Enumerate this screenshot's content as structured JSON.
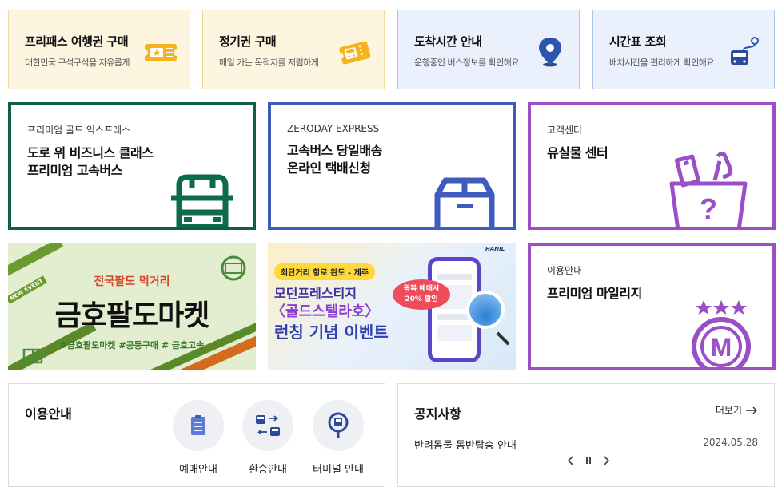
{
  "quick_tiles": [
    {
      "title": "프리패스 여행권 구매",
      "desc": "대한민국 구석구석을 자유롭게",
      "icon": "ticket-star-icon"
    },
    {
      "title": "정기권 구매",
      "desc": "매일 가는 목적지를 저렴하게",
      "icon": "bus-ticket-icon"
    },
    {
      "title": "도착시간 안내",
      "desc": "운행중인 버스정보를 확인해요",
      "icon": "location-pin-icon"
    },
    {
      "title": "시간표 조회",
      "desc": "배차시간을 편리하게 확인해요",
      "icon": "route-bus-icon"
    }
  ],
  "feature_tiles": [
    {
      "sub": "프리미엄 골드 익스프레스",
      "title": "도로 위 비즈니스 클래스\n프리미엄 고속버스",
      "icon": "premium-bus-icon",
      "color": "#0d5e45"
    },
    {
      "sub": "ZERODAY EXPRESS",
      "title": "고속버스 당일배송\n온라인 택배신청",
      "icon": "parcel-box-icon",
      "color": "#3f5bbf"
    },
    {
      "sub": "고객센터",
      "title": "유실물 센터",
      "icon": "lost-item-box-icon",
      "color": "#9a4fc7"
    }
  ],
  "banners": {
    "market": {
      "kicker": "전국팔도 먹거리",
      "headline": "금호팔도마켓",
      "tags": "#금호팔도마켓 #공동구매 # 금호고속",
      "ribbon": "NEW EVENT"
    },
    "ferry": {
      "badge": "최단거리 항로 완도 - 제주",
      "line1": "모던프레스티지",
      "line2": "〈골드스텔라호〉",
      "line3": "런칭 기념 이벤트",
      "discount": "왕복 예매시\n20% 할인",
      "brand": "HANIL"
    }
  },
  "mileage": {
    "sub": "이용안내",
    "title": "프리미엄 마일리지",
    "icon": "mileage-medal-icon",
    "color": "#9a4fc7"
  },
  "guide": {
    "title": "이용안내",
    "items": [
      {
        "label": "예매안내",
        "icon": "document-icon"
      },
      {
        "label": "환승안내",
        "icon": "transfer-bus-icon"
      },
      {
        "label": "터미널 안내",
        "icon": "terminal-sign-icon"
      }
    ]
  },
  "notice": {
    "title": "공지사항",
    "more": "더보기",
    "items": [
      {
        "text": "반려동물 동반탑승 안내",
        "date": "2024.05.28"
      }
    ]
  }
}
